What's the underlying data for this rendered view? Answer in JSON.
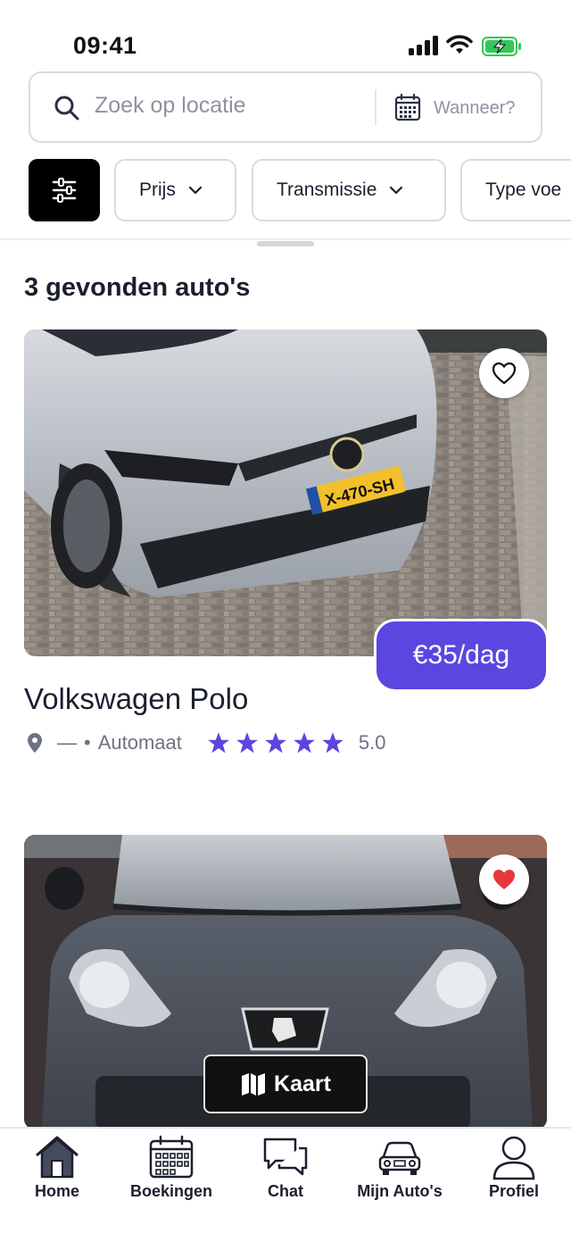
{
  "status_bar": {
    "time": "09:41"
  },
  "search": {
    "placeholder": "Zoek op locatie",
    "when_label": "Wanneer?"
  },
  "filters": {
    "chips": [
      {
        "label": "Prijs"
      },
      {
        "label": "Transmissie"
      },
      {
        "label": "Type voe"
      }
    ]
  },
  "results": {
    "title": "3 gevonden auto's",
    "cars": [
      {
        "name": "Volkswagen Polo",
        "price": "€35/dag",
        "location": "—",
        "separator": "•",
        "transmission": "Automaat",
        "rating": "5.0",
        "stars": 5,
        "favorited": false,
        "plate": "X-470-SH"
      },
      {
        "favorited": true
      }
    ]
  },
  "map_button": {
    "label": "Kaart"
  },
  "tabs": [
    {
      "label": "Home",
      "icon": "home-icon"
    },
    {
      "label": "Boekingen",
      "icon": "calendar-icon"
    },
    {
      "label": "Chat",
      "icon": "chat-icon"
    },
    {
      "label": "Mijn Auto's",
      "icon": "car-icon"
    },
    {
      "label": "Profiel",
      "icon": "user-icon"
    }
  ],
  "colors": {
    "accent": "#5b46e0",
    "star": "#5b46e0",
    "heart": "#e5383b",
    "dark": "#111111"
  }
}
